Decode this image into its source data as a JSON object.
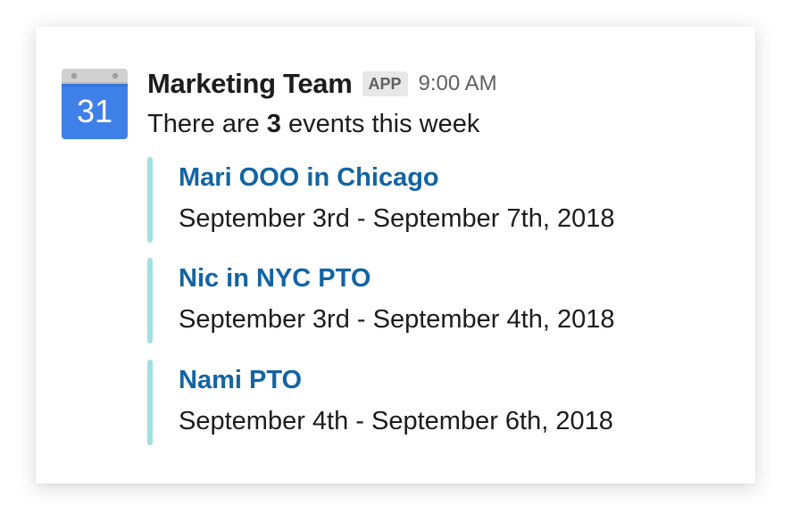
{
  "app": {
    "icon_name": "google-calendar-icon",
    "icon_text": "31",
    "icon_colors": {
      "top": "#d3d3d3",
      "body": "#3f7fe8",
      "text": "#ffffff"
    }
  },
  "message": {
    "sender": "Marketing Team",
    "badge": "APP",
    "time": "9:00 AM",
    "summary_prefix": "There are ",
    "summary_count": "3",
    "summary_suffix": " events this week"
  },
  "events": [
    {
      "title": "Mari OOO in Chicago",
      "dates": "September 3rd - September 7th, 2018"
    },
    {
      "title": "Nic in NYC PTO",
      "dates": "September 3rd - September 4th, 2018"
    },
    {
      "title": "Nami PTO",
      "dates": "September 4th - September 6th, 2018"
    }
  ],
  "colors": {
    "link": "#1264a3",
    "attachment_bar": "#9fe0e2",
    "text": "#1d1c1d",
    "muted": "#616061"
  }
}
